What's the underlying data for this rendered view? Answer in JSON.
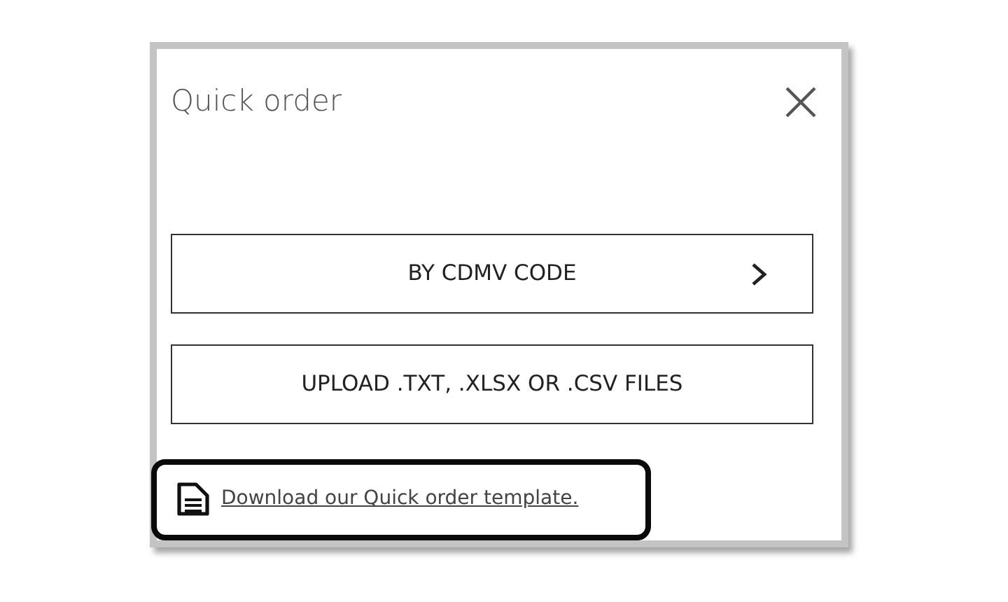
{
  "dialog": {
    "title": "Quick order"
  },
  "options": [
    {
      "label": "BY CDMV CODE",
      "has_chevron": true
    },
    {
      "label": "UPLOAD .TXT, .XLSX OR .CSV FILES",
      "has_chevron": false
    }
  ],
  "template_link": {
    "text": "Download our Quick order template.",
    "highlighted": true
  }
}
